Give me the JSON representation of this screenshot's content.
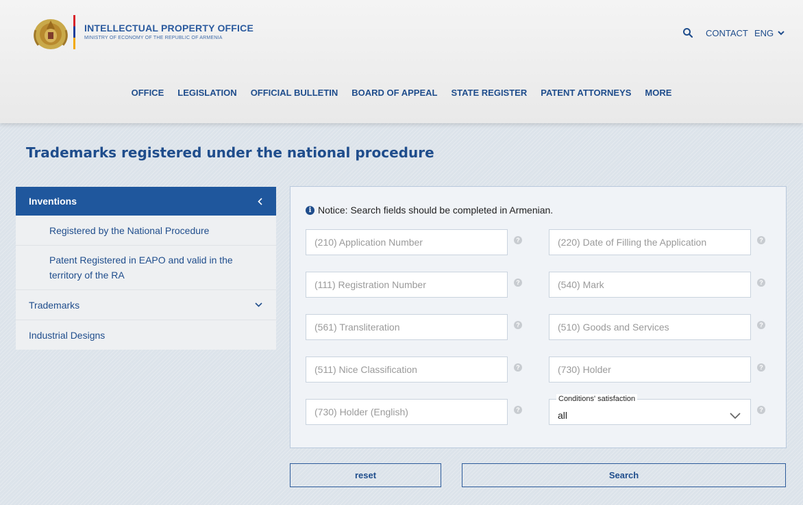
{
  "header": {
    "office_name": "INTELLECTUAL PROPERTY OFFICE",
    "ministry_name": "MINISTRY OF ECONOMY OF THE REPUBLIC OF ARMENIA",
    "contact": "CONTACT",
    "language": "ENG",
    "icons": {
      "search": "search-icon",
      "language_toggle": "chevron-down-icon",
      "logo": "coat-of-arms"
    }
  },
  "nav": {
    "items": [
      {
        "label": "OFFICE"
      },
      {
        "label": "LEGISLATION"
      },
      {
        "label": "OFFICIAL BULLETIN"
      },
      {
        "label": "BOARD OF APPEAL"
      },
      {
        "label": "STATE REGISTER"
      },
      {
        "label": "PATENT ATTORNEYS"
      },
      {
        "label": "MORE"
      }
    ]
  },
  "page": {
    "title": "Trademarks registered under the national procedure"
  },
  "sidebar": {
    "active": "Inventions",
    "sub_items": [
      {
        "label": "Registered by the National Procedure"
      },
      {
        "label": "Patent Registered in EAPO and valid in the territory of the RA"
      }
    ],
    "items": [
      {
        "label": "Trademarks"
      },
      {
        "label": "Industrial Designs"
      }
    ]
  },
  "form": {
    "notice": "Notice: Search fields should be completed in Armenian.",
    "fields": [
      {
        "placeholder": "(210) Application Number"
      },
      {
        "placeholder": "(220) Date of Filling the Application"
      },
      {
        "placeholder": "(111) Registration Number"
      },
      {
        "placeholder": "(540) Mark"
      },
      {
        "placeholder": "(561) Transliteration"
      },
      {
        "placeholder": "(510) Goods and Services"
      },
      {
        "placeholder": "(511) Nice Classification"
      },
      {
        "placeholder": "(730) Holder"
      },
      {
        "placeholder": "(730) Holder (English)"
      }
    ],
    "conditions": {
      "label": "Conditions' satisfaction",
      "value": "all"
    },
    "help_glyph": "?",
    "info_glyph": "i",
    "reset_label": "reset",
    "search_label": "Search"
  },
  "colors": {
    "primary": "#1f4d8c",
    "active_sidebar": "#1f579d",
    "flag_red": "#d8242b",
    "flag_blue": "#1f3f9a",
    "flag_orange": "#f2a900"
  }
}
